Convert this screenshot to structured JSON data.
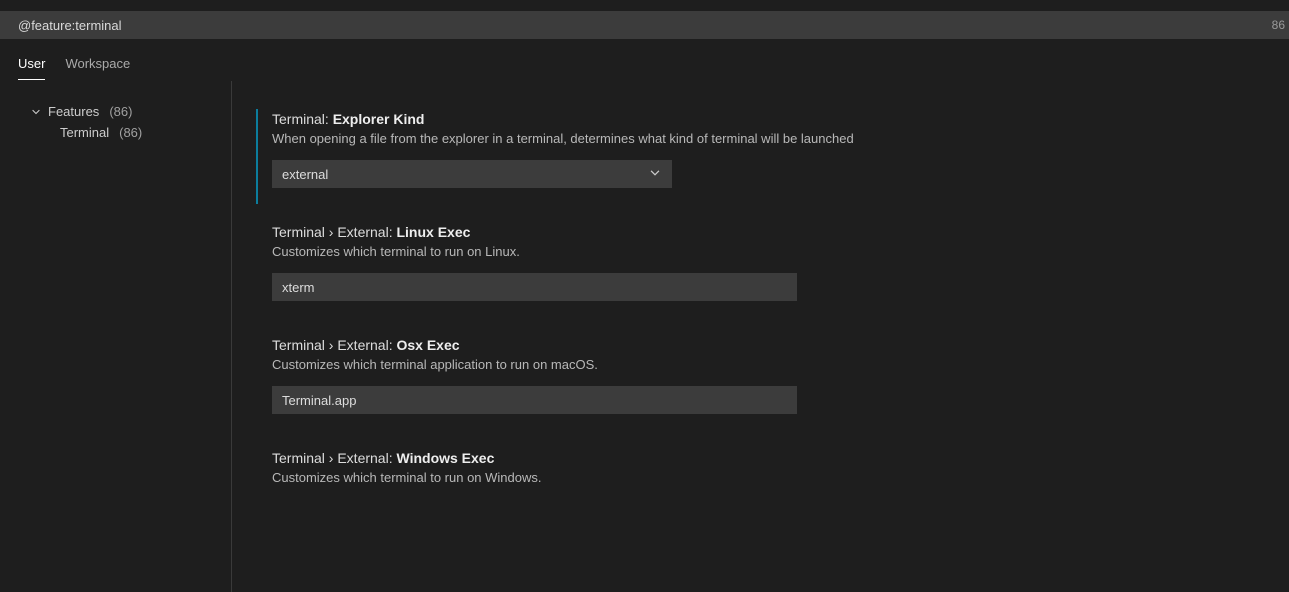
{
  "search": {
    "value": "@feature:terminal",
    "result_count": "86"
  },
  "tabs": {
    "user": "User",
    "workspace": "Workspace"
  },
  "sidebar": {
    "features_label": "Features",
    "features_count": "(86)",
    "terminal_label": "Terminal",
    "terminal_count": "(86)"
  },
  "settings": [
    {
      "prefix": "Terminal: ",
      "name": "Explorer Kind",
      "description": "When opening a file from the explorer in a terminal, determines what kind of terminal will be launched",
      "control": "select",
      "value": "external",
      "modified": true
    },
    {
      "prefix": "Terminal › External: ",
      "name": "Linux Exec",
      "description": "Customizes which terminal to run on Linux.",
      "control": "text",
      "value": "xterm",
      "modified": false
    },
    {
      "prefix": "Terminal › External: ",
      "name": "Osx Exec",
      "description": "Customizes which terminal application to run on macOS.",
      "control": "text",
      "value": "Terminal.app",
      "modified": false
    },
    {
      "prefix": "Terminal › External: ",
      "name": "Windows Exec",
      "description": "Customizes which terminal to run on Windows.",
      "control": "text",
      "value": "",
      "modified": false
    }
  ]
}
